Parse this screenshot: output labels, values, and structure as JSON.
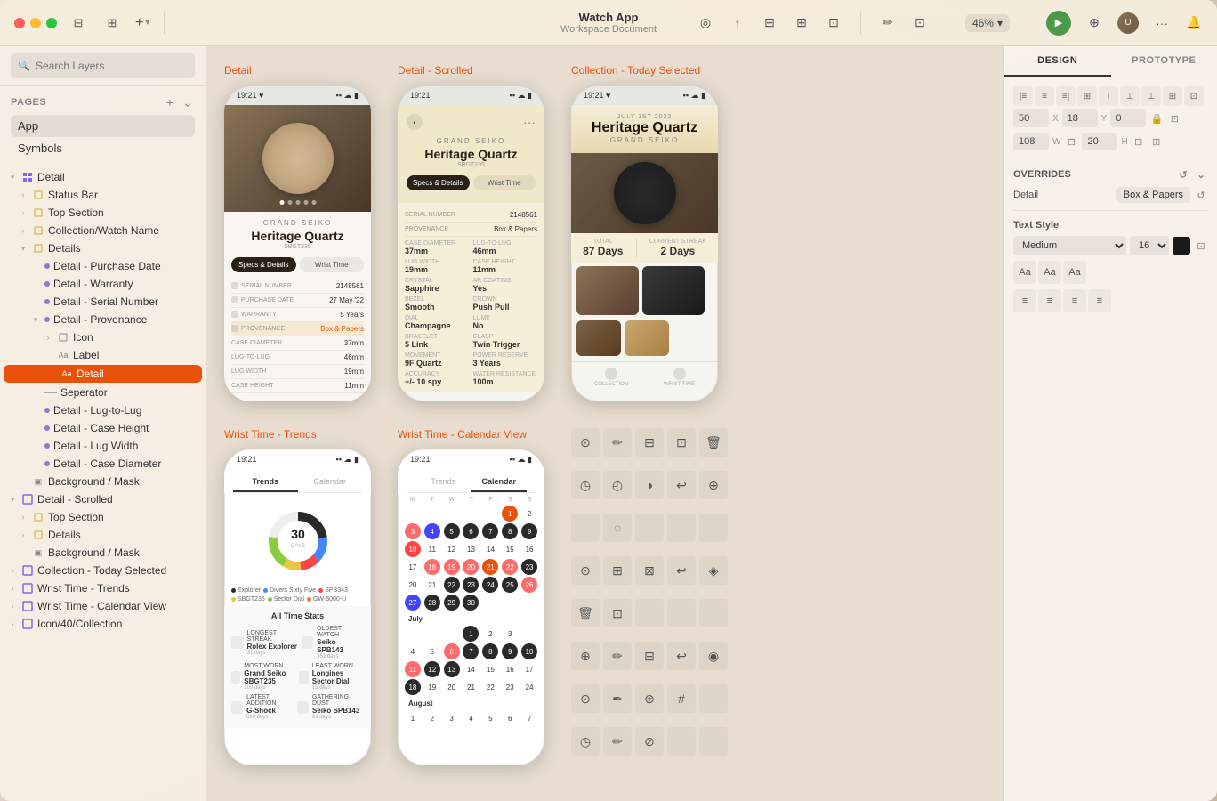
{
  "window": {
    "title": "Watch App",
    "subtitle": "Workspace Document"
  },
  "titlebar": {
    "zoom_level": "46%",
    "add_label": "+",
    "tabs": [
      "DESIGN",
      "PROTOTYPE"
    ]
  },
  "sidebar": {
    "search_placeholder": "Search Layers",
    "pages_label": "Pages",
    "pages": [
      {
        "label": "App",
        "active": true
      },
      {
        "label": "Symbols",
        "active": false
      }
    ],
    "tree": [
      {
        "label": "Detail",
        "level": 0,
        "expanded": true,
        "type": "group"
      },
      {
        "label": "Status Bar",
        "level": 1,
        "type": "component"
      },
      {
        "label": "Top Section",
        "level": 1,
        "type": "component"
      },
      {
        "label": "Collection/Watch Name",
        "level": 1,
        "type": "component"
      },
      {
        "label": "Details",
        "level": 1,
        "type": "group",
        "expanded": true
      },
      {
        "label": "Detail - Purchase Date",
        "level": 2,
        "type": "symbol"
      },
      {
        "label": "Detail - Warranty",
        "level": 2,
        "type": "symbol"
      },
      {
        "label": "Detail - Serial Number",
        "level": 2,
        "type": "symbol"
      },
      {
        "label": "Detail - Provenance",
        "level": 2,
        "type": "symbol",
        "expanded": true
      },
      {
        "label": "Icon",
        "level": 3,
        "type": "group"
      },
      {
        "label": "Label",
        "level": 3,
        "type": "text"
      },
      {
        "label": "Detail",
        "level": 3,
        "type": "text",
        "active": true
      },
      {
        "label": "Seperator",
        "level": 2,
        "type": "line"
      },
      {
        "label": "Detail - Lug-to-Lug",
        "level": 2,
        "type": "symbol"
      },
      {
        "label": "Detail - Case Height",
        "level": 2,
        "type": "symbol"
      },
      {
        "label": "Detail - Lug Width",
        "level": 2,
        "type": "symbol"
      },
      {
        "label": "Detail - Case Diameter",
        "level": 2,
        "type": "symbol"
      },
      {
        "label": "Background / Mask",
        "level": 1,
        "type": "mask"
      },
      {
        "label": "Detail - Scrolled",
        "level": 0,
        "type": "group",
        "expanded": true
      },
      {
        "label": "Top Section",
        "level": 1,
        "type": "component"
      },
      {
        "label": "Details",
        "level": 1,
        "type": "group"
      },
      {
        "label": "Background / Mask",
        "level": 1,
        "type": "mask"
      },
      {
        "label": "Collection - Today Selected",
        "level": 0,
        "type": "group"
      },
      {
        "label": "Wrist Time - Trends",
        "level": 0,
        "type": "group"
      },
      {
        "label": "Wrist Time - Calendar View",
        "level": 0,
        "type": "group"
      },
      {
        "label": "Icon/40/Collection",
        "level": 0,
        "type": "group"
      }
    ]
  },
  "canvas": {
    "frames": [
      {
        "title": "Detail",
        "accent": "#e8520a",
        "type": "detail"
      },
      {
        "title": "Detail - Scrolled",
        "accent": "#e8520a",
        "type": "detail-scrolled"
      },
      {
        "title": "Collection - Today Selected",
        "accent": "#e8520a",
        "type": "collection"
      },
      {
        "title": "Wrist Time - Trends",
        "accent": "#e8520a",
        "type": "wristtime-trends"
      },
      {
        "title": "Wrist Time - Calendar View",
        "accent": "#e8520a",
        "type": "wristtime-calendar"
      }
    ],
    "watch": {
      "brand": "GRAND SEIKO",
      "name": "Heritage Quartz",
      "ref": "SBGT235",
      "time": "19:21"
    }
  },
  "right_panel": {
    "tabs": [
      "DESIGN",
      "PROTOTYPE"
    ],
    "active_tab": "DESIGN",
    "position": {
      "x": "50",
      "y": "18",
      "d": "0",
      "w": "108",
      "h": "20"
    },
    "overrides_label": "OVERRIDES",
    "override_item": "Detail",
    "override_value": "Box & Papers",
    "text_style_label": "Text Style",
    "text_style": "Medium",
    "text_size": "16",
    "align_icons": [
      "≡",
      "≡",
      "≡",
      "≡"
    ]
  },
  "icons": {
    "search": "🔍",
    "chevron_right": "›",
    "chevron_down": "∨",
    "plus": "+",
    "add": "⊕",
    "play": "▶",
    "share": "↑",
    "filter": "⊟",
    "crop": "⊞",
    "link": "🔗",
    "pen": "✏",
    "frame": "⊡",
    "zoom_arrow": "▾",
    "user": "👤",
    "bell": "🔔",
    "more": "•••",
    "back": "‹",
    "back_circle": "←"
  }
}
